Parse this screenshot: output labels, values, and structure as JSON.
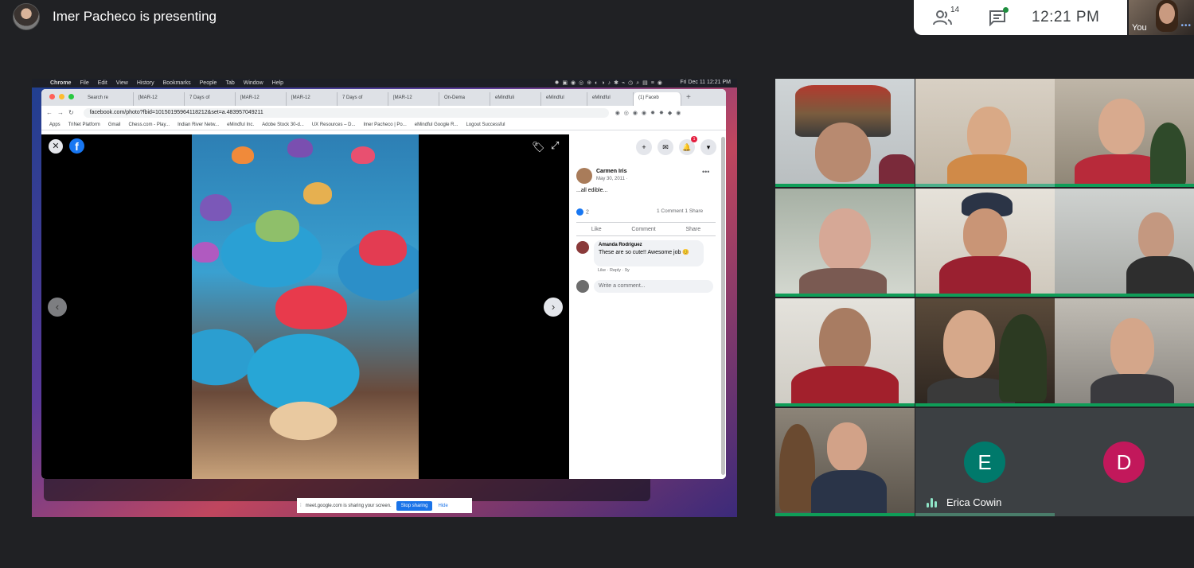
{
  "header": {
    "presenter_text": "Imer Pacheco is presenting",
    "participant_count": "14",
    "time": "12:21 PM",
    "self_label": "You"
  },
  "shared_screen": {
    "mac_menu": [
      "Chrome",
      "File",
      "Edit",
      "View",
      "History",
      "Bookmarks",
      "People",
      "Tab",
      "Window",
      "Help"
    ],
    "mac_clock": "Fri Dec 11  12:21 PM",
    "tabs": [
      "Search re",
      "[MAR-12",
      "7 Days of",
      "[MAR-12",
      "[MAR-12",
      "7 Days of",
      "[MAR-12",
      "On-Dema",
      "eMindfuli",
      "eMindful",
      "eMindful",
      "(1) Faceb"
    ],
    "url": "facebook.com/photo?fbid=10150195964118212&set=a.483957049211",
    "bookmarks": [
      "Apps",
      "TriNet Platform",
      "Gmail",
      "Chess.com - Play...",
      "Indian River Netw...",
      "eMindful Inc.",
      "Adobe Stock 30-d...",
      "UX Resources – D...",
      "Imer Pacheco | Po...",
      "eMindful Google R...",
      "Logout Successful"
    ],
    "post": {
      "author": "Carmen Iris",
      "date": "May 30, 2011 · ",
      "text": "...all edible...",
      "reaction_count": "2",
      "counts": "1 Comment  1 Share",
      "actions": [
        "Like",
        "Comment",
        "Share"
      ],
      "comment": {
        "author": "Amanda Rodriguez",
        "text": "These are so cute!! Awesome job 😊",
        "meta": "Like · Reply · 9y",
        "reaction": "1"
      },
      "write_placeholder": "Write a comment..."
    },
    "share_bar": {
      "text": "meet.google.com is sharing your screen.",
      "stop": "Stop sharing",
      "hide": "Hide"
    }
  },
  "participants": {
    "erica_initial": "E",
    "erica_name": "Erica Cowin",
    "erica_color": "#00796b",
    "d_initial": "D",
    "d_color": "#c2185b"
  }
}
